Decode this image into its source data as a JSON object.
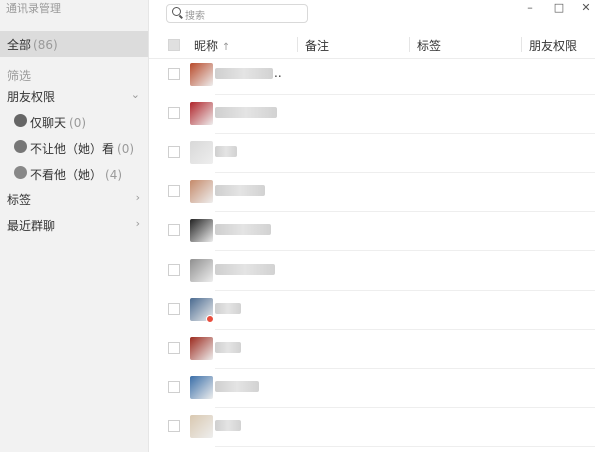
{
  "app_title": "通讯录管理",
  "sidebar": {
    "all": {
      "label": "全部",
      "count": "(86)"
    },
    "filter_title": "筛选",
    "friend_perm": {
      "label": "朋友权限",
      "chevron": "⌄"
    },
    "perm_items": [
      {
        "label": "仅聊天",
        "count": "(0)",
        "icon": "chat-only-icon"
      },
      {
        "label": "不让他（她）看",
        "count": "(0)",
        "icon": "lock-icon"
      },
      {
        "label": "不看他（她）",
        "count": "(4)",
        "icon": "hide-icon"
      }
    ],
    "tags": {
      "label": "标签",
      "chevron": "›"
    },
    "recent_groups": {
      "label": "最近群聊",
      "chevron": "›"
    }
  },
  "search": {
    "placeholder": "搜索"
  },
  "window_controls": {
    "minimize": "–",
    "maximize": "□",
    "close": "✕"
  },
  "table": {
    "headers": {
      "nickname": "昵称",
      "sort_arrow": "↑",
      "remark": "备注",
      "tags": "标签",
      "permission": "朋友权限"
    },
    "rows": [
      {
        "avatar_color": "#b84a2a",
        "name_width": 58,
        "suffix": ".."
      },
      {
        "avatar_color": "#b0242a",
        "name_width": 62,
        "suffix": ""
      },
      {
        "avatar_color": "#d8d8d8",
        "name_width": 22,
        "suffix": ""
      },
      {
        "avatar_color": "#c58a6a",
        "name_width": 50,
        "suffix": ""
      },
      {
        "avatar_color": "#222222",
        "name_width": 56,
        "suffix": ""
      },
      {
        "avatar_color": "#8f8f8f",
        "name_width": 60,
        "suffix": ""
      },
      {
        "avatar_color": "#4a6a90",
        "name_width": 26,
        "suffix": "",
        "badge": true
      },
      {
        "avatar_color": "#9c2a1e",
        "name_width": 26,
        "suffix": ""
      },
      {
        "avatar_color": "#3a6ea8",
        "name_width": 44,
        "suffix": ""
      },
      {
        "avatar_color": "#d9c8b0",
        "name_width": 26,
        "suffix": ""
      }
    ]
  }
}
